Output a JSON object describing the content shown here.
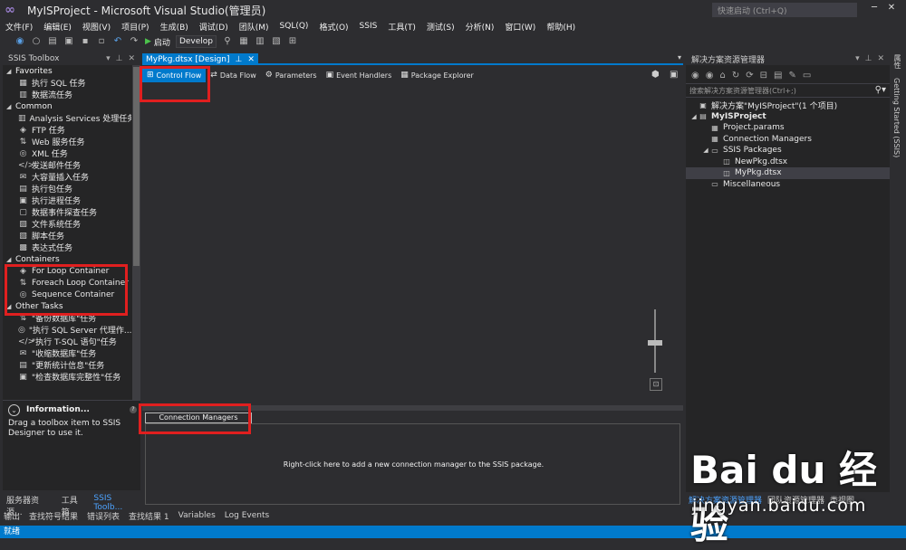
{
  "title_bar": {
    "app_title": "MyISProject - Microsoft Visual Studio(管理员)",
    "quick_launch_placeholder": "快速启动 (Ctrl+Q)",
    "logo": "vs-logo"
  },
  "menu": [
    "文件(F)",
    "编辑(E)",
    "视图(V)",
    "项目(P)",
    "生成(B)",
    "调试(D)",
    "团队(M)",
    "SQL(Q)",
    "格式(O)",
    "SSIS",
    "工具(T)",
    "测试(S)",
    "分析(N)",
    "窗口(W)",
    "帮助(H)"
  ],
  "toolbar": {
    "start_label": "启动",
    "config_value": "Develop"
  },
  "toolbox": {
    "title": "SSIS Toolbox",
    "groups": [
      {
        "name": "Favorites",
        "items": [
          "执行 SQL 任务",
          "数据流任务"
        ]
      },
      {
        "name": "Common",
        "items": [
          "Analysis Services 处理任务",
          "FTP 任务",
          "Web 服务任务",
          "XML 任务",
          "发送邮件任务",
          "大容量插入任务",
          "执行包任务",
          "执行进程任务",
          "数据事件探查任务",
          "文件系统任务",
          "脚本任务",
          "表达式任务"
        ]
      },
      {
        "name": "Containers",
        "items": [
          "For Loop Container",
          "Foreach Loop Container",
          "Sequence Container"
        ]
      },
      {
        "name": "Other Tasks",
        "items": [
          "\"备份数据库\"任务",
          "\"执行 SQL Server 代理作...",
          "\"执行 T-SQL 语句\"任务",
          "\"收缩数据库\"任务",
          "\"更新统计信息\"任务",
          "\"检查数据库完整性\"任务"
        ]
      }
    ]
  },
  "info": {
    "title": "Information...",
    "text": "Drag a toolbox item to SSIS Designer to use it."
  },
  "left_tabs": [
    "服务器资源...",
    "工具箱",
    "SSIS Toolb..."
  ],
  "document": {
    "tab_label": "MyPkg.dtsx [Design]",
    "designer_tabs": [
      "Control Flow",
      "Data Flow",
      "Parameters",
      "Event Handlers",
      "Package Explorer"
    ],
    "connection_managers_tab": "Connection Managers",
    "connection_hint": "Right-click here to add a new connection manager to the SSIS package."
  },
  "solution_explorer": {
    "title": "解决方案资源管理器",
    "search_placeholder": "搜索解决方案资源管理器(Ctrl+;)",
    "tree": [
      {
        "label": "解决方案\"MyISProject\"(1 个项目)",
        "level": 0,
        "expander": ""
      },
      {
        "label": "MyISProject",
        "level": 0,
        "expander": "◢",
        "bold": true
      },
      {
        "label": "Project.params",
        "level": 1,
        "expander": ""
      },
      {
        "label": "Connection Managers",
        "level": 1,
        "expander": ""
      },
      {
        "label": "SSIS Packages",
        "level": 1,
        "expander": "◢"
      },
      {
        "label": "NewPkg.dtsx",
        "level": 2,
        "expander": ""
      },
      {
        "label": "MyPkg.dtsx",
        "level": 2,
        "expander": "",
        "selected": true
      },
      {
        "label": "Miscellaneous",
        "level": 1,
        "expander": ""
      }
    ]
  },
  "right_bottom_tabs": [
    "解决方案资源管理器",
    "团队资源管理器",
    "类视图"
  ],
  "right_rail_tabs": [
    "属性",
    "Getting Started (SSIS)"
  ],
  "output_tabs": [
    "输出",
    "查找符号结果",
    "错误列表",
    "查找结果 1",
    "Variables",
    "Log Events"
  ],
  "status": "就绪",
  "watermark": {
    "main": "Bai du 经验",
    "url": "jingyan.baidu.com"
  },
  "colors": {
    "accent": "#007acc",
    "highlight": "#e01f1f",
    "background": "#2d2d30",
    "panel": "#252526"
  }
}
